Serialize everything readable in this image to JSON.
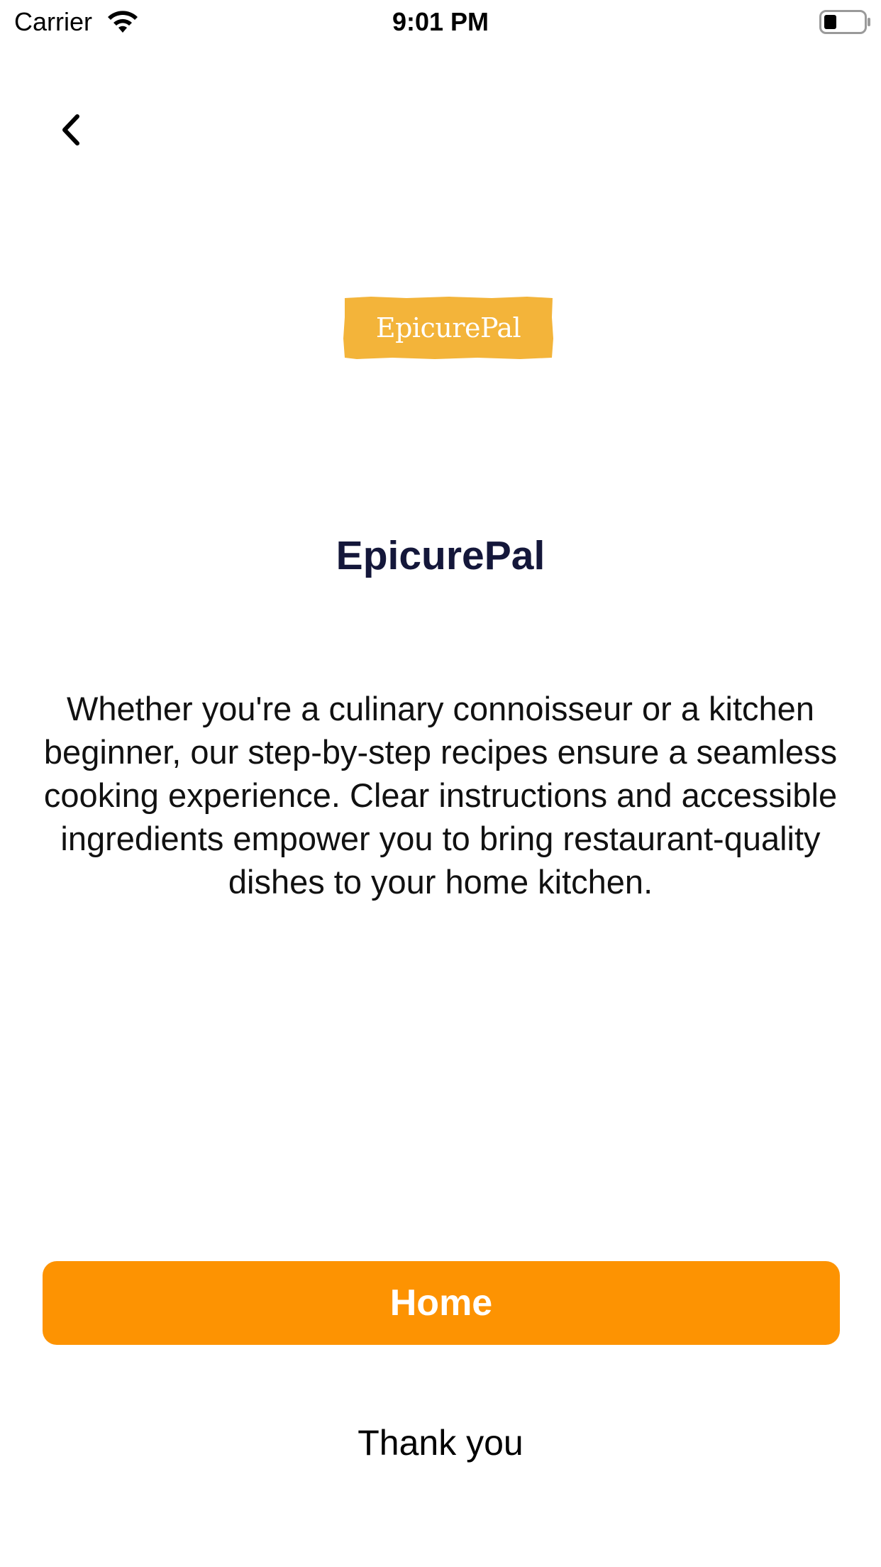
{
  "status_bar": {
    "carrier": "Carrier",
    "time": "9:01 PM",
    "wifi_icon": "wifi-icon",
    "battery_icon": "battery-icon"
  },
  "nav": {
    "back_icon": "chevron-left-icon"
  },
  "logo": {
    "text": "EpicurePal",
    "color": "#f3b43a"
  },
  "main": {
    "title": "EpicurePal",
    "description": "Whether you're a culinary connoisseur or a kitchen beginner, our step-by-step recipes ensure a seamless cooking experience. Clear instructions and accessible ingredients empower you to bring restaurant-quality dishes to your home kitchen."
  },
  "actions": {
    "home_label": "Home",
    "home_color": "#fd9302",
    "thank_you": "Thank you"
  }
}
